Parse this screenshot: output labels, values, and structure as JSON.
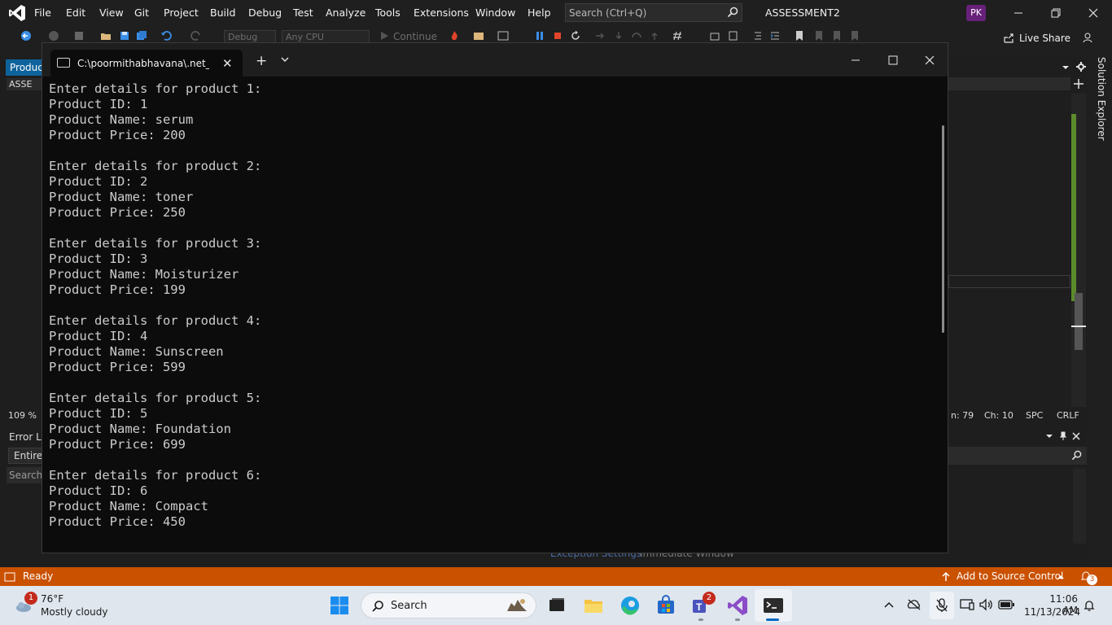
{
  "vs": {
    "menu": [
      "File",
      "Edit",
      "View",
      "Git",
      "Project",
      "Build",
      "Debug",
      "Test",
      "Analyze",
      "Tools",
      "Extensions",
      "Window",
      "Help"
    ],
    "search_placeholder": "Search (Ctrl+Q)",
    "solution_name": "ASSESSMENT2",
    "avatar_initials": "PK",
    "toolbar": {
      "config_combo": "Debug",
      "platform_combo": "Any CPU",
      "continue_label": "Continue",
      "live_share_label": "Live Share"
    },
    "editor_tab": "Product",
    "nav_combo": "ASSE",
    "zoom": "109 %",
    "position": {
      "line": "n: 79",
      "col": "Ch: 10",
      "spc": "SPC",
      "eol": "CRLF"
    },
    "solution_explorer_label": "Solution Explorer",
    "error_list": {
      "title": "Error Lis",
      "scope": "Entire",
      "search": "Search"
    },
    "bottom_tabs": {
      "exception": "Exception Settings",
      "immediate": "Immediate Window"
    },
    "status": {
      "ready": "Ready",
      "source_control": "Add to Source Control",
      "notifications": "3"
    },
    "brand_color": "#68217a",
    "status_color": "#ca5100"
  },
  "terminal": {
    "tab_title": "C:\\poormithabhavana\\.net_tra",
    "lines": [
      "Enter details for product 1:",
      "Product ID: 1",
      "Product Name: serum",
      "Product Price: 200",
      "",
      "Enter details for product 2:",
      "Product ID: 2",
      "Product Name: toner",
      "Product Price: 250",
      "",
      "Enter details for product 3:",
      "Product ID: 3",
      "Product Name: Moisturizer",
      "Product Price: 199",
      "",
      "Enter details for product 4:",
      "Product ID: 4",
      "Product Name: Sunscreen",
      "Product Price: 599",
      "",
      "Enter details for product 5:",
      "Product ID: 5",
      "Product Name: Foundation",
      "Product Price: 699",
      "",
      "Enter details for product 6:",
      "Product ID: 6",
      "Product Name: Compact",
      "Product Price: 450"
    ]
  },
  "taskbar": {
    "weather": {
      "temp": "76°F",
      "desc": "Mostly cloudy",
      "badge": "1"
    },
    "search_label": "Search",
    "teams_badge": "2",
    "time": "11:06 AM",
    "date": "11/13/2024"
  }
}
